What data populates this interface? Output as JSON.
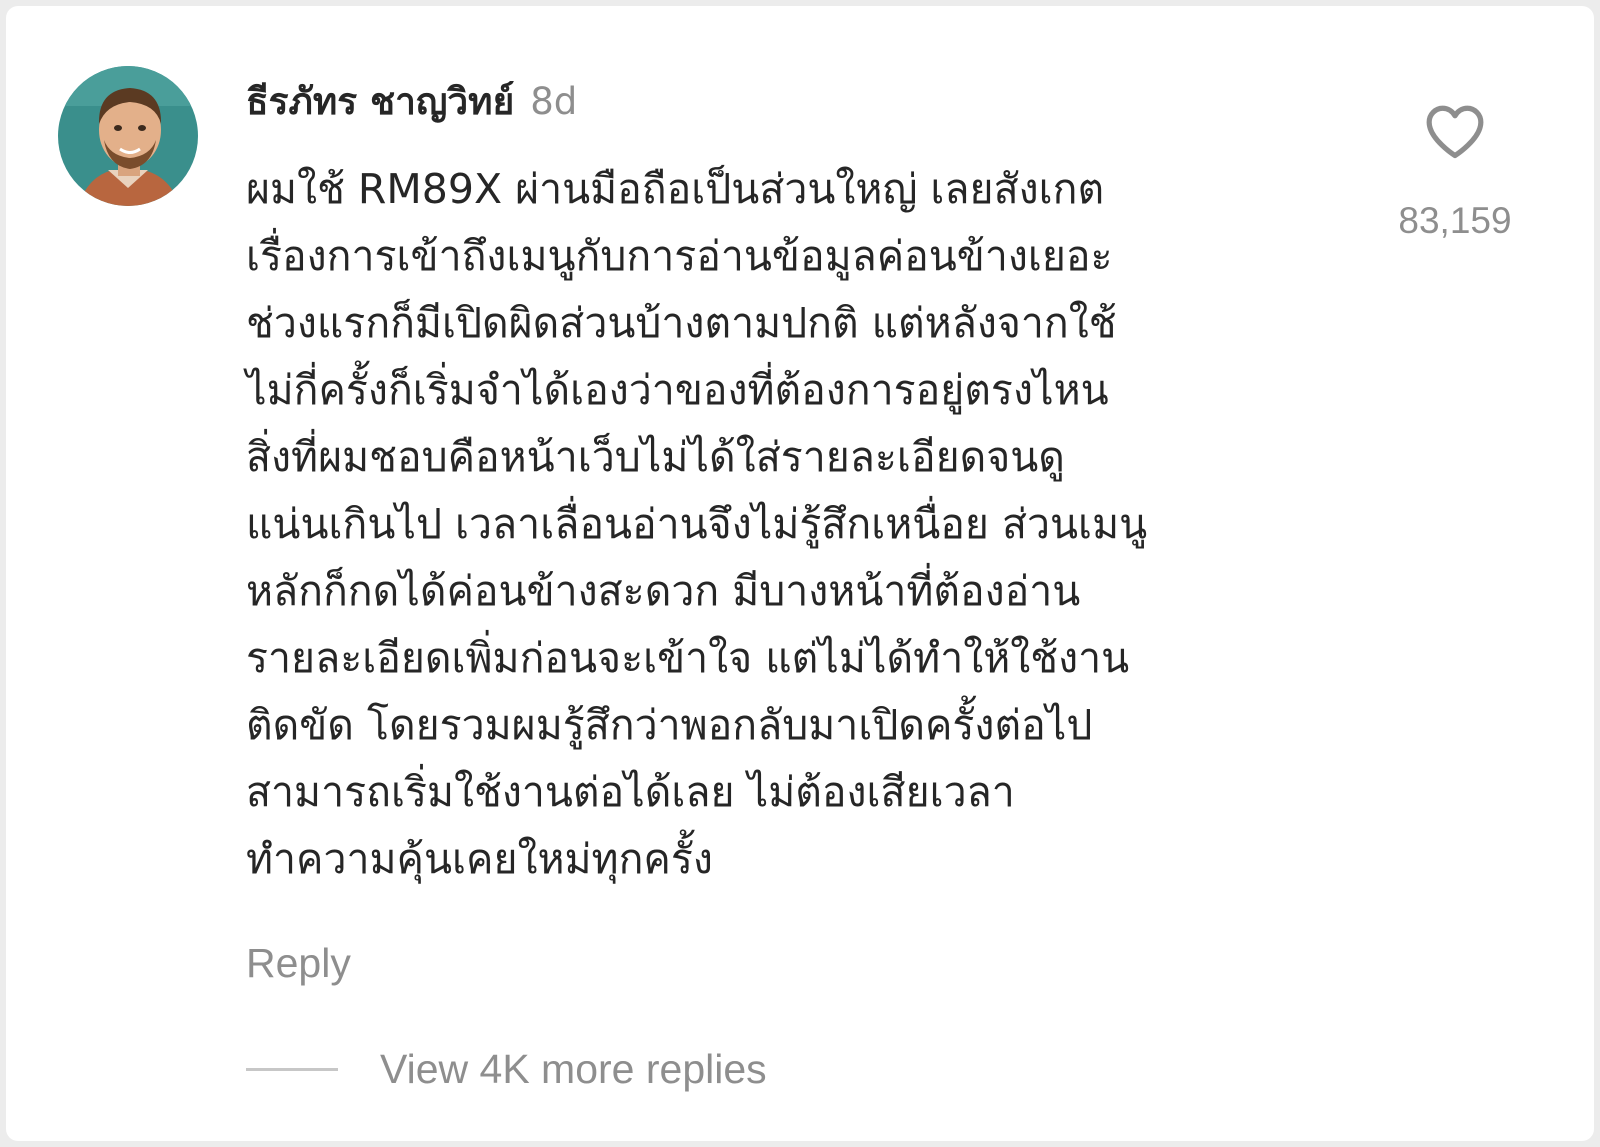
{
  "comment": {
    "author": "ธีรภัทร ชาญวิทย์",
    "time_ago": "8d",
    "lines": [
      "ผมใช้ RM89X ผ่านมือถือเป็นส่วนใหญ่ เลยสังเกต",
      "เรื่องการเข้าถึงเมนูกับการอ่านข้อมูลค่อนข้างเยอะ",
      "ช่วงแรกก็มีเปิดผิดส่วนบ้างตามปกติ แต่หลังจากใช้",
      "ไม่กี่ครั้งก็เริ่มจำได้เองว่าของที่ต้องการอยู่ตรงไหน",
      "สิ่งที่ผมชอบคือหน้าเว็บไม่ได้ใส่รายละเอียดจนดู",
      "แน่นเกินไป เวลาเลื่อนอ่านจึงไม่รู้สึกเหนื่อย ส่วนเมนู",
      "หลักก็กดได้ค่อนข้างสะดวก มีบางหน้าที่ต้องอ่าน",
      "รายละเอียดเพิ่มก่อนจะเข้าใจ แต่ไม่ได้ทำให้ใช้งาน",
      "ติดขัด โดยรวมผมรู้สึกว่าพอกลับมาเปิดครั้งต่อไป",
      "สามารถเริ่มใช้งานต่อได้เลย ไม่ต้องเสียเวลา",
      "ทำความคุ้นเคยใหม่ทุกครั้ง"
    ],
    "like_count": "83,159",
    "like_icon": "heart-outline-icon",
    "reply_label": "Reply",
    "view_replies_label": "View 4K more replies"
  },
  "colors": {
    "text_primary": "#262626",
    "text_secondary": "#8e8e8e",
    "avatar_background": "#3a8f8c"
  }
}
